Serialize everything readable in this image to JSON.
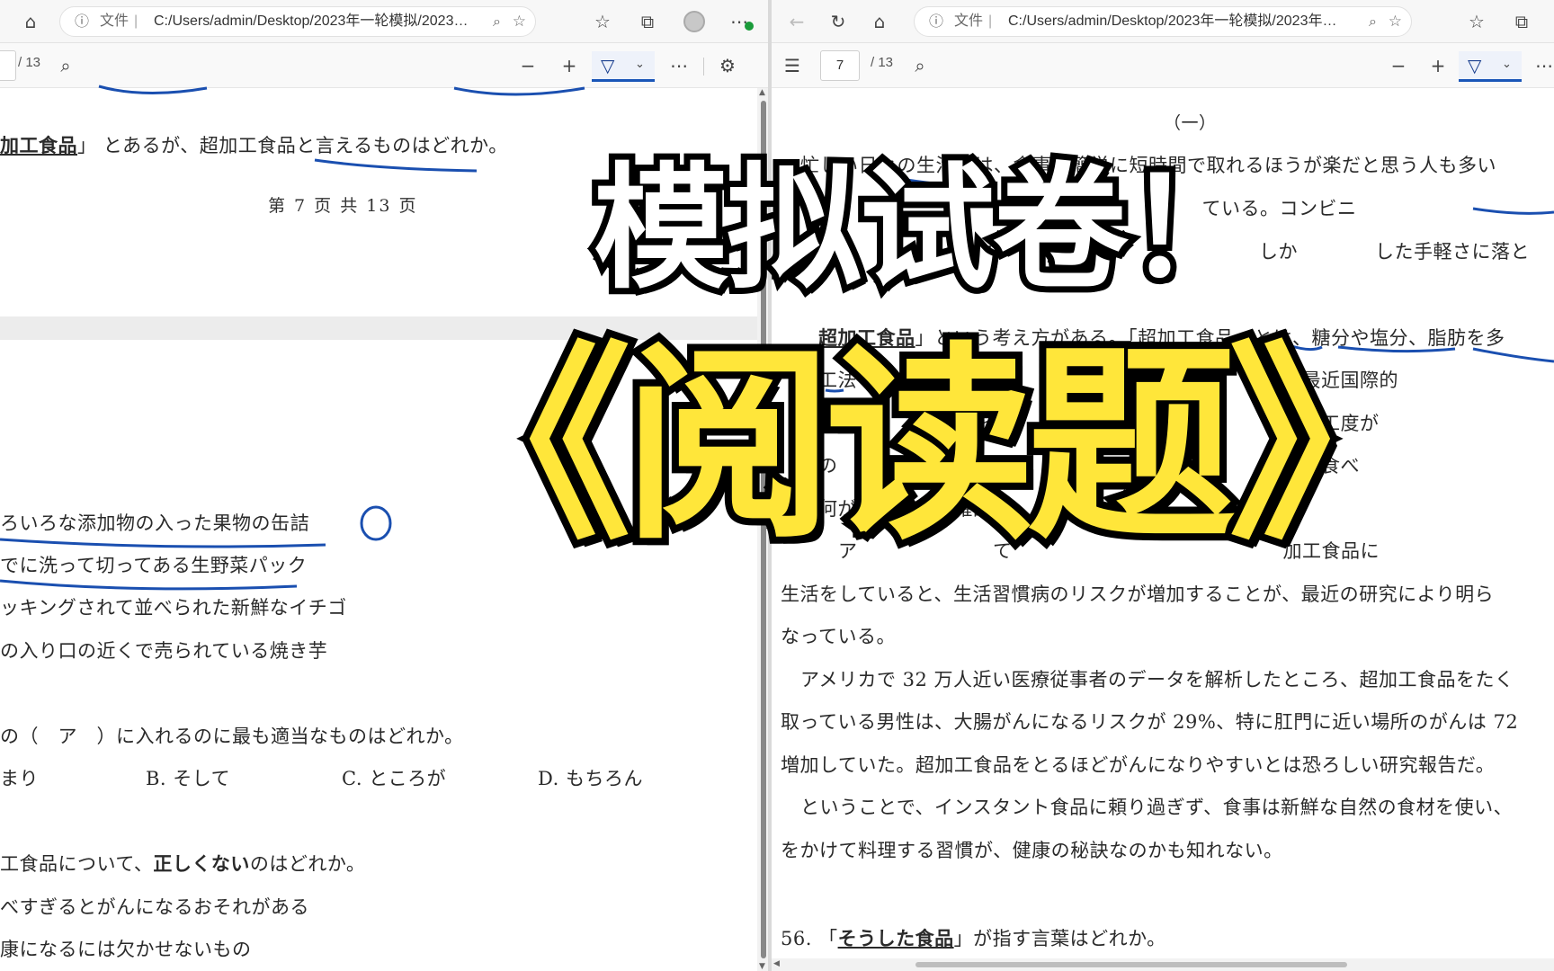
{
  "left": {
    "url_label": "文件",
    "url_path": "C:/Users/admin/Desktop/2023年一轮模拟/2023年一...",
    "page_total": "/ 13",
    "lines": {
      "q_top": {
        "pre": "加工食品",
        "close": "」",
        "mid": "とあるが、超加工食品",
        "tail": "と言えるものはどれか。"
      },
      "footer": "第 7 页 共 13 页",
      "o1": "ろいろな添加物の入った果物の缶詰",
      "o2": "でに洗って切ってある生野菜パック",
      "o3": "ッキングされて並べられた新鮮なイチゴ",
      "o4": "の入り口の近くで売られている焼き芋",
      "q_blank": "の（　ア　）に入れるのに最も適当なものはどれか。",
      "choice_a": "まり",
      "choice_b": "B. そして",
      "choice_c": "C. ところが",
      "choice_d": "D. もちろん",
      "q_false_pre": "工食品について、",
      "q_false_bold": "正しくない",
      "q_false_post": "のはどれか。",
      "f1": "べすぎるとがんになるおそれがある",
      "f2": "康になるには欠かせないもの"
    }
  },
  "right": {
    "url_label": "文件",
    "url_path": "C:/Users/admin/Desktop/2023年一轮模拟/2023年一轮...",
    "page_current": "7",
    "page_total": "/ 13",
    "lines": {
      "section": "（一）",
      "r1": "忙しい日々の生活では、食事は簡単に短時間で取れるほうが楽だと思う人も多い",
      "r2": "ろいろ　　　　ている。コンビニ",
      "r3": "しか　　　　した手軽さに落と",
      "r4_pre": "超加工食品",
      "r4_post": "」という考え方がある。「超加工食品」とは、糖分や塩分、脂肪を多",
      "r5": "工法　　　　　　　れ　　　　　　　　　　　　　　　最近国際的",
      "r6": "知　　　　　　　を加　　　　　に分　　　　　　　　加工度が",
      "r7": "の　　　　　　ン　　　　　　　　な、手　　　　　　ま食べ",
      "r8": "何が　　　　　確認　　　　　　のこ",
      "r9": "ア　　　　　　　て　　　　　　　　　　　　　　加工食品に",
      "r10": "生活をしていると、生活習慣病のリスクが増加することが、最近の研究により明ら",
      "r11": "なっている。",
      "r12": "アメリカで 32 万人近い医療従事者のデータを解析したところ、超加工食品をたく",
      "r13": "取っている男性は、大腸がんになるリスクが 29%、特に肛門に近い場所のがんは 72",
      "r14": "増加していた。超加工食品をとるほどがんになりやすいとは恐ろしい研究報告だ。",
      "r15": "ということで、インスタント食品に頼り過ぎず、食事は新鮮な自然の食材を使い、",
      "r16": "をかけて料理する習慣が、健康の秘訣なのかも知れない。",
      "q56_num": "56. 「",
      "q56_target": "そうした食品",
      "q56_tail": "」が指す言葉はどれか。"
    }
  },
  "overlay": {
    "title": "模拟试卷！",
    "subtitle": "《阅读题》"
  },
  "colors": {
    "ink": "#1a4fb0",
    "overlay_yellow": "#ffe63a",
    "accent": "#1a56b8"
  }
}
